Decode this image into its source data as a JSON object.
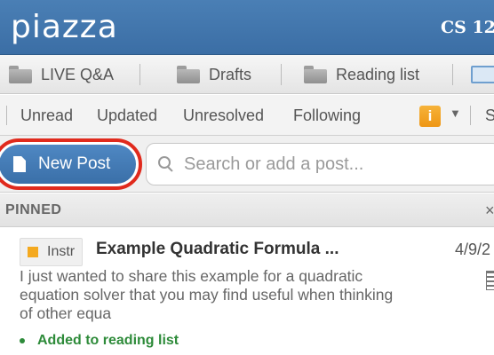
{
  "header": {
    "logo": "piazza",
    "course": "CS 12"
  },
  "folders": [
    {
      "label": "LIVE Q&A"
    },
    {
      "label": "Drafts"
    },
    {
      "label": "Reading list"
    }
  ],
  "filters": {
    "unread": "Unread",
    "updated": "Updated",
    "unresolved": "Unresolved",
    "following": "Following",
    "info_glyph": "i",
    "cut_text": "S"
  },
  "actions": {
    "new_post": "New Post",
    "search_placeholder": "Search or add a post..."
  },
  "pinned": {
    "label": "PINNED",
    "close_glyph": "×"
  },
  "post": {
    "tag": "Instr",
    "title": "Example Quadratic Formula ...",
    "date": "4/9/2",
    "excerpt": "I just wanted to share this example for a quadratic equation solver that you may find useful when thinking of other equa",
    "status": "Added to reading list"
  },
  "colors": {
    "header_bg": "#3b6ea5",
    "new_post_bg": "#3a6fa8",
    "highlight_ring": "#e02a1d",
    "tag_square": "#f4a91f",
    "status_green": "#2e8b3a"
  }
}
